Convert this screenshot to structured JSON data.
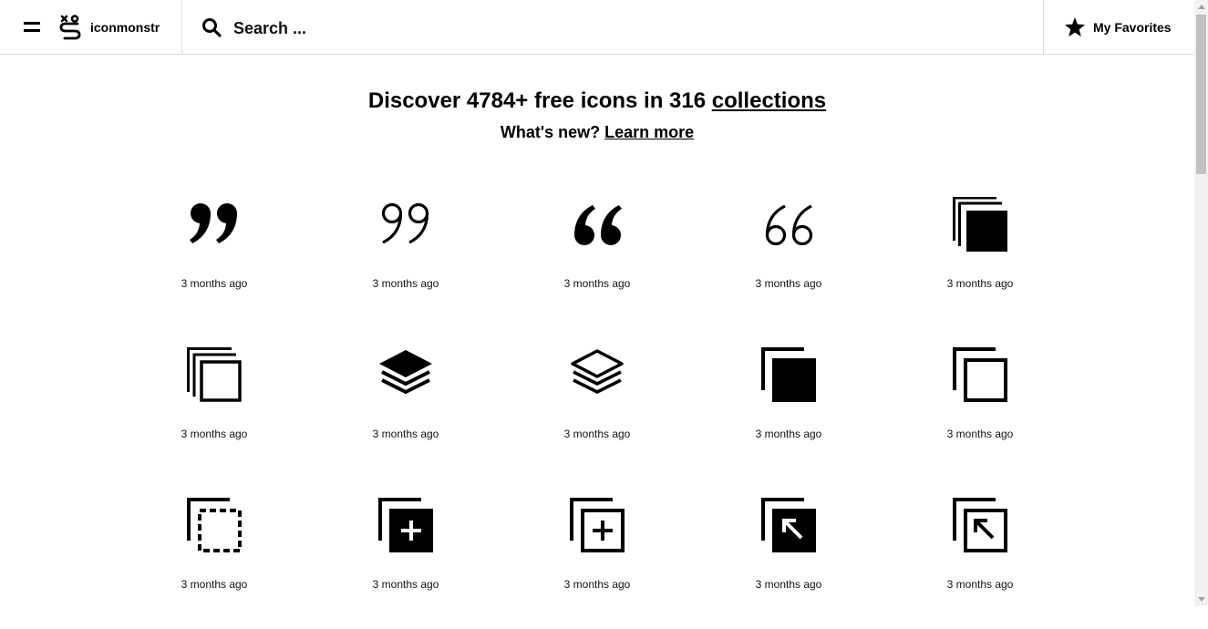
{
  "header": {
    "logo_text": "iconmonstr",
    "search_placeholder": "Search ...",
    "favorites_label": "My Favorites"
  },
  "hero": {
    "title_prefix": "Discover 4784+ free icons in 316 ",
    "title_link": "collections",
    "subtitle_prefix": "What's new? ",
    "subtitle_link": "Learn more"
  },
  "icons": [
    {
      "name": "quote-filled-icon",
      "time": "3 months ago"
    },
    {
      "name": "quote-outline-icon",
      "time": "3 months ago"
    },
    {
      "name": "quote-open-filled-icon",
      "time": "3 months ago"
    },
    {
      "name": "quote-open-outline-icon",
      "time": "3 months ago"
    },
    {
      "name": "stack-filled-icon",
      "time": "3 months ago"
    },
    {
      "name": "stack-outline-icon",
      "time": "3 months ago"
    },
    {
      "name": "layers-filled-icon",
      "time": "3 months ago"
    },
    {
      "name": "layers-outline-icon",
      "time": "3 months ago"
    },
    {
      "name": "copy-filled-icon",
      "time": "3 months ago"
    },
    {
      "name": "copy-outline-icon",
      "time": "3 months ago"
    },
    {
      "name": "copy-dashed-icon",
      "time": "3 months ago"
    },
    {
      "name": "copy-add-filled-icon",
      "time": "3 months ago"
    },
    {
      "name": "copy-add-outline-icon",
      "time": "3 months ago"
    },
    {
      "name": "copy-arrow-filled-icon",
      "time": "3 months ago"
    },
    {
      "name": "copy-arrow-outline-icon",
      "time": "3 months ago"
    }
  ]
}
